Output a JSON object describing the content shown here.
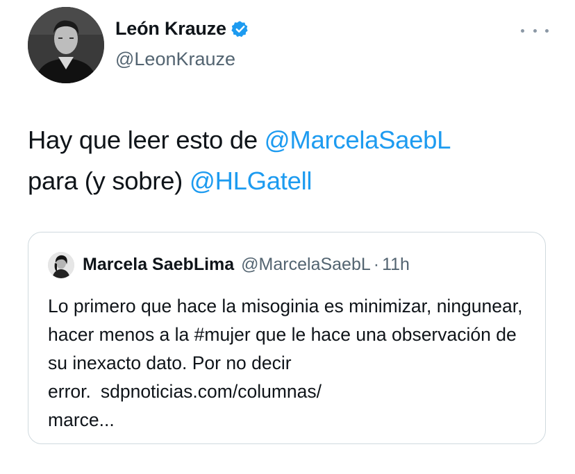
{
  "author": {
    "name": "León Krauze",
    "handle": "@LeonKrauze",
    "verified": true,
    "avatar": "person-avatar"
  },
  "tweet": {
    "text_part1": "Hay que leer esto de ",
    "mention1": "@MarcelaSaebL",
    "text_part2": "para (y sobre) ",
    "mention2": "@HLGatell"
  },
  "quoted": {
    "name": "Marcela SaebLima",
    "handle": "@MarcelaSaebL",
    "separator": "·",
    "time": "11h",
    "text": "Lo primero que hace la misoginia es minimizar, ningunear, hacer menos a la #mujer que le hace una observación de su inexacto dato. Por no decir error.",
    "link": "sdpnoticias.com/columnas/",
    "link_cont": "marce..."
  },
  "icons": {
    "more": "more-dots-icon",
    "verified": "verified-badge-icon"
  },
  "colors": {
    "mention": "#1d9bf0",
    "secondary_text": "#536471",
    "border": "#cfd9de",
    "verified": "#1d9bf0"
  }
}
